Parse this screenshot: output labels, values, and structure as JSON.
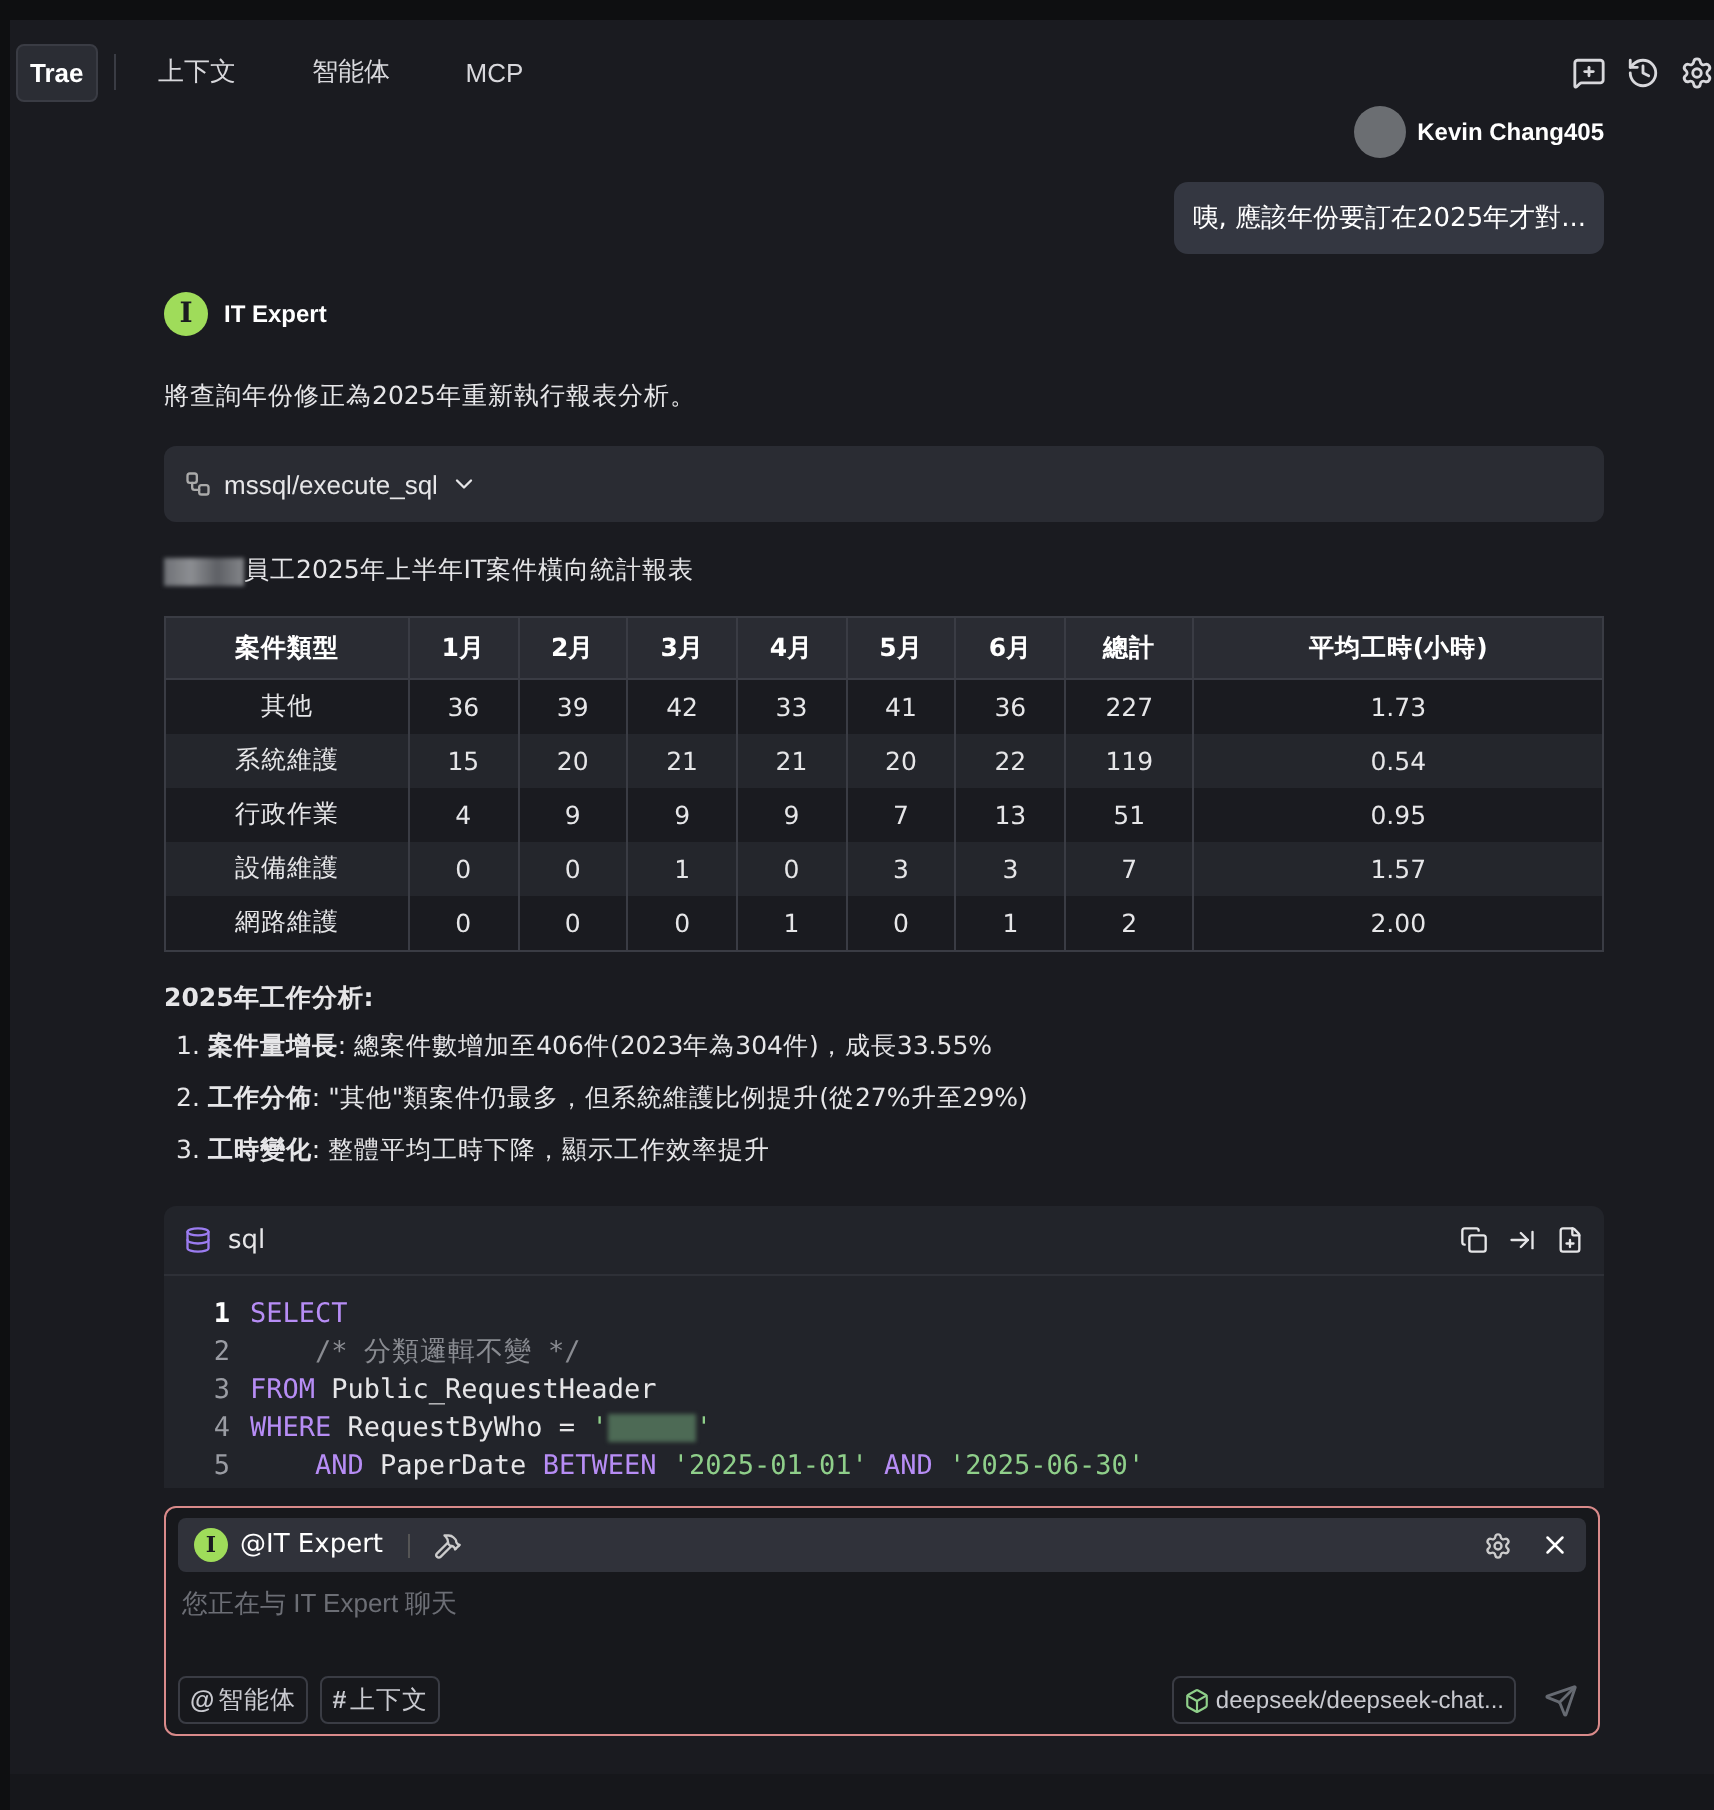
{
  "tabs": [
    {
      "label": "Trae",
      "selected": true
    },
    {
      "label": "上下文",
      "selected": false
    },
    {
      "label": "智能体",
      "selected": false
    },
    {
      "label": "MCP",
      "selected": false
    }
  ],
  "user": {
    "name": "Kevin Chang405",
    "message": "咦, 應該年份要訂在2025年才對..."
  },
  "assistant": {
    "avatar_letter": "I",
    "name": "IT Expert",
    "intro": "將查詢年份修正為2025年重新執行報表分析。",
    "tool_call": {
      "label": "mssql/execute_sql",
      "expanded": false
    },
    "report_title": "員工2025年上半年IT案件橫向統計報表",
    "table": {
      "columns": [
        "案件類型",
        "1月",
        "2月",
        "3月",
        "4月",
        "5月",
        "6月",
        "總計",
        "平均工時(小時)"
      ],
      "rows": [
        [
          "其他",
          "36",
          "39",
          "42",
          "33",
          "41",
          "36",
          "227",
          "1.73"
        ],
        [
          "系統維護",
          "15",
          "20",
          "21",
          "21",
          "20",
          "22",
          "119",
          "0.54"
        ],
        [
          "行政作業",
          "4",
          "9",
          "9",
          "9",
          "7",
          "13",
          "51",
          "0.95"
        ],
        [
          "設備維護",
          "0",
          "0",
          "1",
          "0",
          "3",
          "3",
          "7",
          "1.57"
        ],
        [
          "網路維護",
          "0",
          "0",
          "0",
          "1",
          "0",
          "1",
          "2",
          "2.00"
        ]
      ]
    },
    "analysis_title": "2025年工作分析:",
    "analysis": [
      {
        "number": "1.",
        "heading": "案件量增長",
        "text": ": 總案件數增加至406件(2023年為304件)，成長33.55%"
      },
      {
        "number": "2.",
        "heading": "工作分佈",
        "text": ": \"其他\"類案件仍最多，但系統維護比例提升(從27%升至29%)"
      },
      {
        "number": "3.",
        "heading": "工時變化",
        "text": ": 整體平均工時下降，顯示工作效率提升"
      }
    ],
    "code": {
      "language": "sql",
      "lines": [
        {
          "number": "1",
          "current": true,
          "tokens": [
            {
              "kind": "keyword",
              "text": "SELECT"
            }
          ]
        },
        {
          "number": "2",
          "current": false,
          "tokens": [
            {
              "kind": "comment",
              "text": "    /* 分類邏輯不變 */"
            }
          ]
        },
        {
          "number": "3",
          "current": false,
          "tokens": [
            {
              "kind": "keyword",
              "text": "FROM"
            },
            {
              "kind": "plain",
              "text": " Public_RequestHeader"
            }
          ]
        },
        {
          "number": "4",
          "current": false,
          "tokens": [
            {
              "kind": "keyword",
              "text": "WHERE"
            },
            {
              "kind": "plain",
              "text": " RequestByWho = "
            },
            {
              "kind": "string",
              "text": "'"
            },
            {
              "kind": "redacted"
            },
            {
              "kind": "string",
              "text": "'"
            }
          ]
        },
        {
          "number": "5",
          "current": false,
          "tokens": [
            {
              "kind": "keyword",
              "text": "    AND"
            },
            {
              "kind": "plain",
              "text": " PaperDate "
            },
            {
              "kind": "keyword",
              "text": "BETWEEN"
            },
            {
              "kind": "string",
              "text": " '2025-01-01'"
            },
            {
              "kind": "keyword",
              "text": " AND"
            },
            {
              "kind": "string",
              "text": " '2025-06-30'"
            }
          ]
        }
      ]
    }
  },
  "composer": {
    "agent_letter": "I",
    "agent": "@IT Expert",
    "placeholder": "您正在与 IT Expert 聊天",
    "chips": [
      {
        "symbol": "@",
        "label": "智能体"
      },
      {
        "symbol": "#",
        "label": "上下文"
      }
    ],
    "model": "deepseek/deepseek-chat..."
  }
}
